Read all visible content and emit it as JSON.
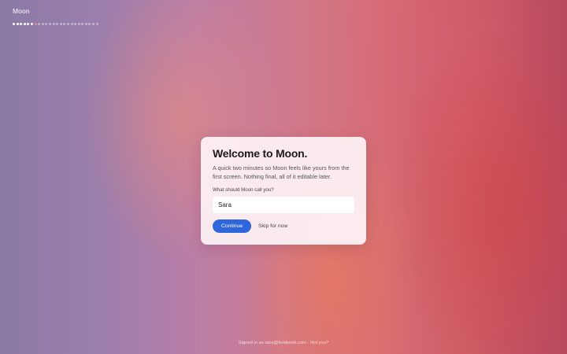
{
  "app": {
    "title": "Moon"
  },
  "progress": {
    "total_steps": 24,
    "completed_steps": 6,
    "current_step": 7,
    "colors": {
      "done": "#ffffff",
      "current": "#f07fae",
      "pending": "rgba(255,255,255,0.42)"
    }
  },
  "card": {
    "title": "Welcome to Moon.",
    "subtitle": "A quick two minutes so Moon feels like yours from the first screen. Nothing final, all of it editable later.",
    "name_label": "What should Moon call you?",
    "name_value": "Sara",
    "continue_label": "Continue",
    "skip_label": "Skip for now"
  },
  "footer": {
    "signed_in_text": "Signed in as sara@fieldwork.com",
    "separator": " · ",
    "not_you_label": "Not you?"
  },
  "colors": {
    "accent": "#2f66dc"
  }
}
